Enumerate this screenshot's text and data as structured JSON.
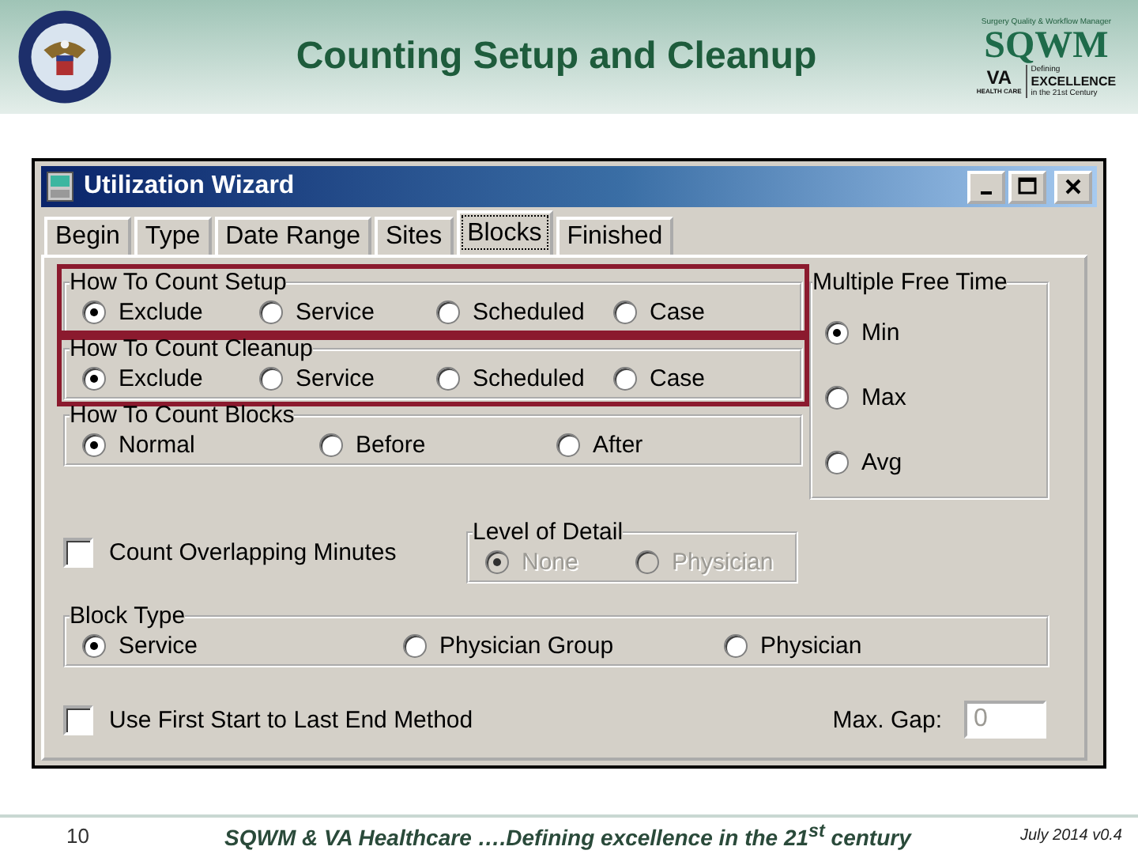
{
  "slide": {
    "title": "Counting Setup and Cleanup",
    "logo": {
      "tagline": "Surgery Quality & Workflow Manager",
      "name": "SQWM",
      "va": "VA",
      "va_sub": "HEALTH CARE",
      "motto_top": "Defining",
      "motto_main": "EXCELLENCE",
      "motto_bottom": "in the 21st Century"
    }
  },
  "window": {
    "title": "Utilization Wizard",
    "tabs": [
      {
        "label": "Begin",
        "selected": false
      },
      {
        "label": "Type",
        "selected": false
      },
      {
        "label": "Date Range",
        "selected": false
      },
      {
        "label": "Sites",
        "selected": false
      },
      {
        "label": "Blocks",
        "selected": true
      },
      {
        "label": "Finished",
        "selected": false
      }
    ],
    "left_groups": [
      {
        "legend": "How To Count Setup",
        "highlighted": true,
        "options": [
          {
            "label": "Exclude",
            "selected": true
          },
          {
            "label": "Service",
            "selected": false
          },
          {
            "label": "Scheduled",
            "selected": false
          },
          {
            "label": "Case",
            "selected": false
          }
        ]
      },
      {
        "legend": "How To Count Cleanup",
        "highlighted": true,
        "options": [
          {
            "label": "Exclude",
            "selected": true
          },
          {
            "label": "Service",
            "selected": false
          },
          {
            "label": "Scheduled",
            "selected": false
          },
          {
            "label": "Case",
            "selected": false
          }
        ]
      },
      {
        "legend": "How To Count Blocks",
        "highlighted": false,
        "options": [
          {
            "label": "Normal",
            "selected": true
          },
          {
            "label": "Before",
            "selected": false
          },
          {
            "label": "After",
            "selected": false
          }
        ]
      }
    ],
    "free_time": {
      "legend": "Multiple Free Time",
      "options": [
        {
          "label": "Min",
          "selected": true
        },
        {
          "label": "Max",
          "selected": false
        },
        {
          "label": "Avg",
          "selected": false
        }
      ]
    },
    "overlap_checkbox": {
      "label": "Count Overlapping Minutes",
      "checked": false
    },
    "level_of_detail": {
      "legend": "Level of Detail",
      "disabled": true,
      "options": [
        {
          "label": "None",
          "selected": true
        },
        {
          "label": "Physician",
          "selected": false
        }
      ]
    },
    "block_type": {
      "legend": "Block Type",
      "options": [
        {
          "label": "Service",
          "selected": true
        },
        {
          "label": "Physician Group",
          "selected": false
        },
        {
          "label": "Physician",
          "selected": false
        }
      ]
    },
    "first_last_checkbox": {
      "label": "Use First Start to Last End Method",
      "checked": false
    },
    "max_gap": {
      "label": "Max. Gap:",
      "value": "0"
    }
  },
  "footer": {
    "page": "10",
    "text": "SQWM & VA Healthcare ….Defining excellence in the 21$^{st}$ century",
    "version": "July 2014 v0.4"
  }
}
